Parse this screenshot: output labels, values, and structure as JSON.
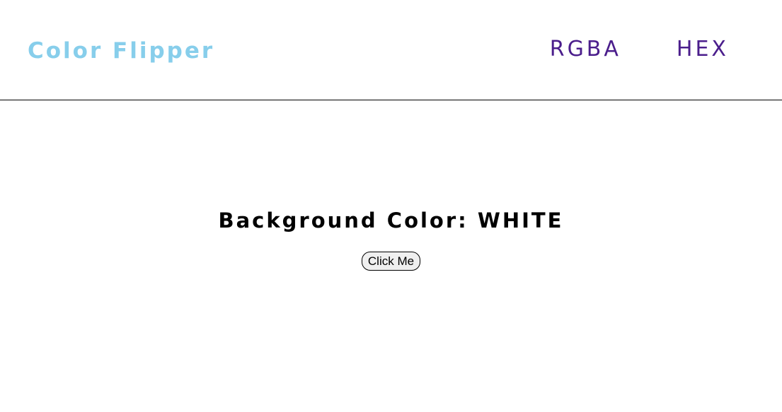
{
  "navbar": {
    "brand": "Color Flipper",
    "links": [
      {
        "label": "RGBA"
      },
      {
        "label": "HEX"
      }
    ]
  },
  "main": {
    "heading": "Background Color: WHITE",
    "button_label": "Click Me"
  },
  "colors": {
    "brand": "#87ceeb",
    "nav_link": "#4b1e8c",
    "background": "#ffffff",
    "text": "#000000"
  }
}
